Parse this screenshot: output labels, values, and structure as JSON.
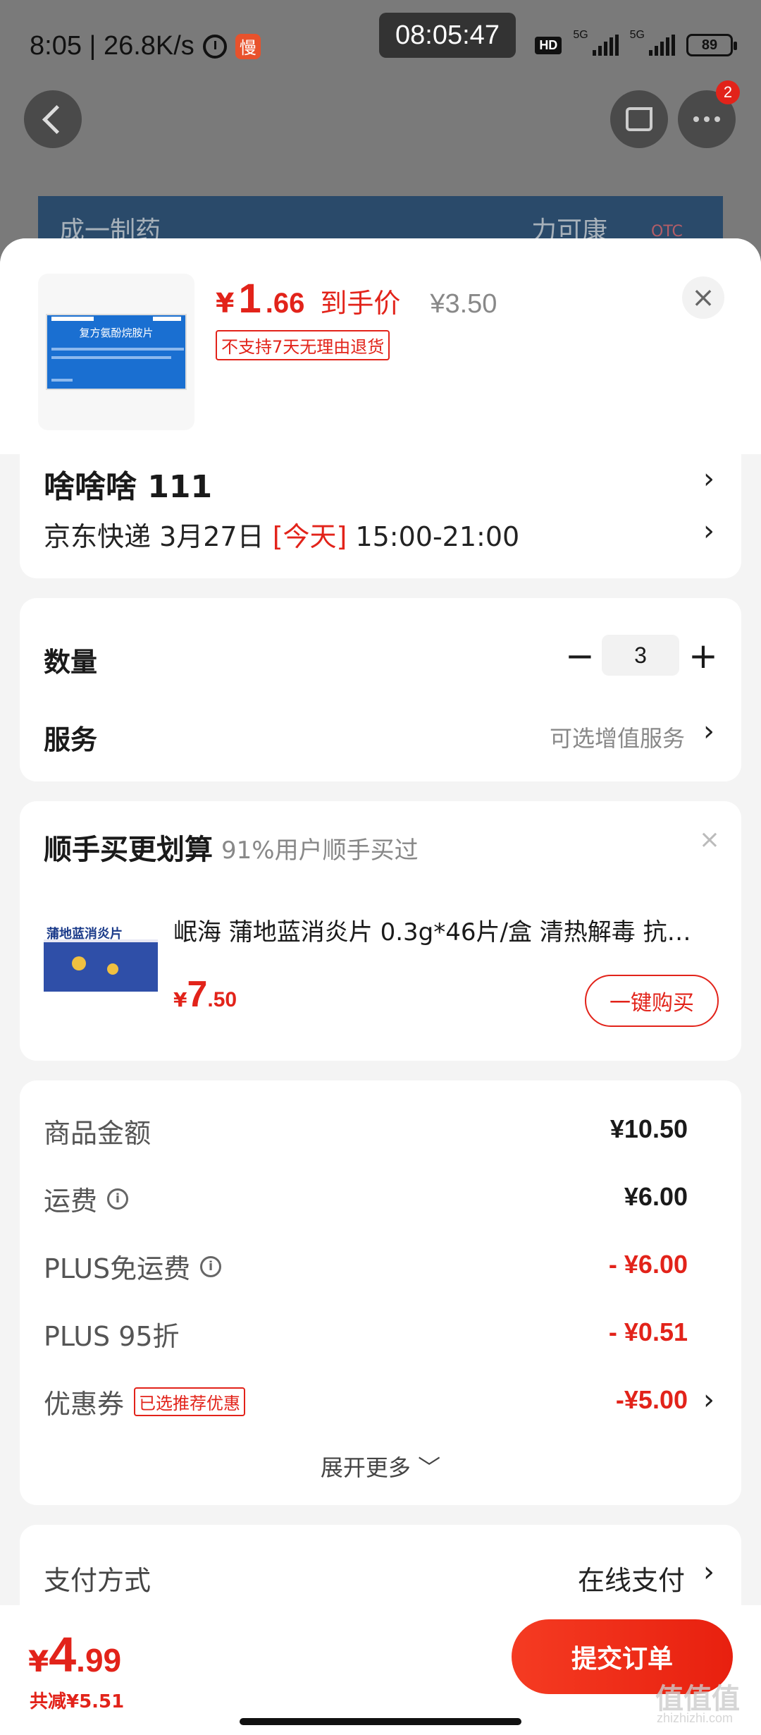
{
  "status_bar": {
    "time_speed": "8:05 | 26.8K/s",
    "app_badge": "慢",
    "clock": "08:05:47",
    "hd": "HD",
    "net1": "5G",
    "net2": "5G",
    "battery": "89"
  },
  "top_nav": {
    "more_badge": "2"
  },
  "bg_product": {
    "brand": "成一制药",
    "name": "力可康",
    "otc": "OTC"
  },
  "product": {
    "thumb_title": "复方氨酚烷胺片",
    "price_yen": "¥",
    "price_int": "1",
    "price_dec": ".66",
    "price_label": "到手价",
    "original_price": "¥3.50",
    "return_tag": "不支持7天无理由退货",
    "close": "×"
  },
  "address": {
    "name": "啥啥啥  111",
    "carrier_date": "京东快递 3月27日 ",
    "today": "[今天]",
    "time_window": " 15:00-21:00"
  },
  "quantity": {
    "label": "数量",
    "minus": "−",
    "value": "3",
    "plus": "+",
    "service_label": "服务",
    "service_value": "可选增值服务"
  },
  "bundle": {
    "title": "顺手买更划算",
    "subtitle": "91%用户顺手买过",
    "close": "×",
    "image_name": "蒲地蓝消炎片",
    "item_name": "岷海 蒲地蓝消炎片 0.3g*46片/盒 清热解毒 抗…",
    "price_yen": "¥",
    "price_int": "7",
    "price_dec": ".50",
    "buy_label": "一键购买"
  },
  "summary": {
    "rows": [
      {
        "label": "商品金额",
        "value": "¥10.50"
      },
      {
        "label": "运费",
        "value": "¥6.00",
        "info": "i"
      },
      {
        "label": "PLUS免运费",
        "value": "- ¥6.00",
        "info": "i"
      },
      {
        "label": "PLUS 95折",
        "value": "- ¥0.51"
      },
      {
        "label": "优惠券",
        "tag": "已选推荐优惠",
        "value": "-¥5.00"
      }
    ],
    "expand": "展开更多 ﹀"
  },
  "payment": {
    "label": "支付方式",
    "value": "在线支付"
  },
  "footer": {
    "total_yen": "¥",
    "total_int": "4",
    "total_dec": ".99",
    "saved": "共减¥5.51",
    "submit": "提交订单",
    "watermark": "值值值",
    "watermark_url": "zhizhizhi.com"
  },
  "colors": {
    "accent": "#e2231a",
    "sheet_bg": "#f4f4f4",
    "overlay": "#7a7a7a"
  },
  "icons": [
    "alarm-icon",
    "hd-icon",
    "signal-icon",
    "battery-icon",
    "back-icon",
    "share-icon",
    "more-icon",
    "close-icon",
    "chevron-right-icon",
    "info-icon",
    "chevron-down-icon"
  ]
}
